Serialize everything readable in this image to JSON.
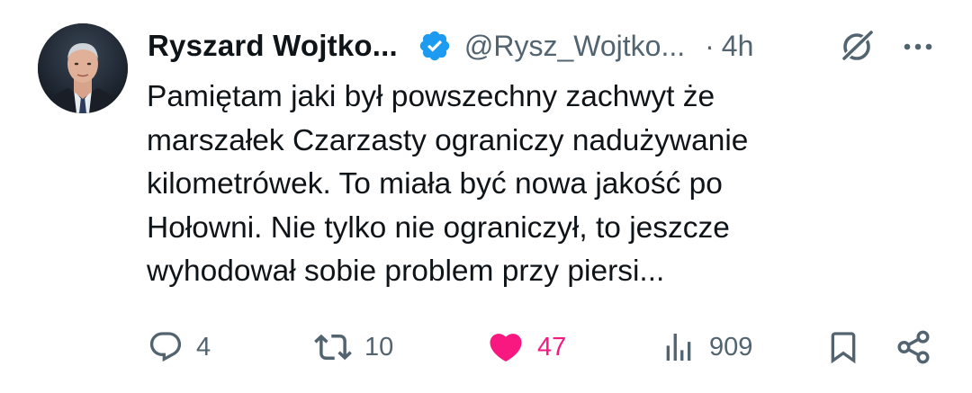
{
  "tweet": {
    "display_name": "Ryszard Wojtko...",
    "handle": "@Rysz_Wojtko...",
    "dot": "·",
    "time": "4h",
    "lines": [
      "Pamiętam jaki był powszechny zachwyt że",
      "marszałek Czarzasty ograniczy nadużywanie",
      "kilometrówek. To miała być nowa jakość po",
      "Hołowni. Nie tylko nie ograniczył, to jeszcze",
      "wyhodował sobie problem przy piersi..."
    ]
  },
  "actions": {
    "replies": "4",
    "reposts": "10",
    "likes": "47",
    "views": "909"
  },
  "icons": {
    "verified": "verified-badge-icon",
    "grok": "grok-icon",
    "more": "more-icon",
    "reply": "reply-icon",
    "repost": "repost-icon",
    "like": "heart-icon",
    "views": "views-icon",
    "bookmark": "bookmark-icon",
    "share": "share-icon"
  },
  "colors": {
    "verified_blue": "#1d9bf0",
    "like_pink": "#f91880",
    "muted_gray": "#536471",
    "text": "#0f1419"
  }
}
